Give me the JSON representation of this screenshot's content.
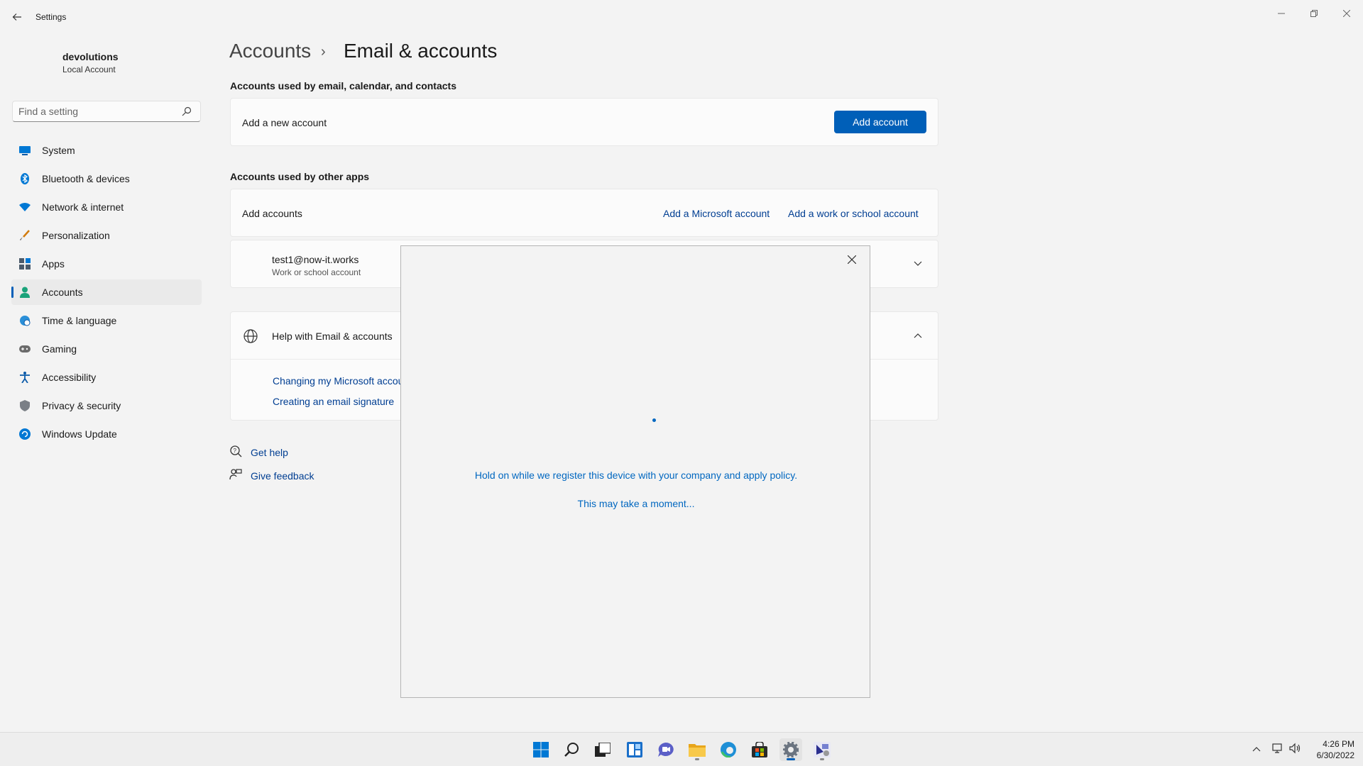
{
  "window": {
    "title": "Settings",
    "back_icon": "back-arrow-icon",
    "controls": [
      "minimize-icon",
      "restore-icon",
      "close-icon"
    ]
  },
  "profile": {
    "name": "devolutions",
    "type": "Local Account"
  },
  "search": {
    "placeholder": "Find a setting",
    "value": ""
  },
  "sidebar": {
    "active_index": 5,
    "items": [
      {
        "label": "System",
        "icon": "system-icon"
      },
      {
        "label": "Bluetooth & devices",
        "icon": "bluetooth-icon"
      },
      {
        "label": "Network & internet",
        "icon": "wifi-icon"
      },
      {
        "label": "Personalization",
        "icon": "brush-icon"
      },
      {
        "label": "Apps",
        "icon": "apps-icon"
      },
      {
        "label": "Accounts",
        "icon": "person-icon"
      },
      {
        "label": "Time & language",
        "icon": "globe-clock-icon"
      },
      {
        "label": "Gaming",
        "icon": "gamepad-icon"
      },
      {
        "label": "Accessibility",
        "icon": "accessibility-icon"
      },
      {
        "label": "Privacy & security",
        "icon": "shield-icon"
      },
      {
        "label": "Windows Update",
        "icon": "update-icon"
      }
    ]
  },
  "breadcrumb": {
    "root": "Accounts",
    "separator": "›",
    "current": "Email & accounts"
  },
  "email_section": {
    "title": "Accounts used by email, calendar, and contacts",
    "row_label": "Add a new account",
    "button": "Add account"
  },
  "apps_section": {
    "title": "Accounts used by other apps",
    "row_label": "Add accounts",
    "link_microsoft": "Add a Microsoft account",
    "link_work": "Add a work or school account",
    "account": {
      "email": "test1@now-it.works",
      "type": "Work or school account"
    }
  },
  "help_section": {
    "title": "Help with Email & accounts",
    "links": [
      "Changing my Microsoft account",
      "Creating an email signature"
    ]
  },
  "footer_links": {
    "get_help": "Get help",
    "give_feedback": "Give feedback"
  },
  "dialog": {
    "message": "Hold on while we register this device with your company and apply policy.",
    "submessage": "This may take a moment..."
  },
  "taskbar": {
    "icons": [
      "start-icon",
      "search-icon",
      "task-view-icon",
      "widgets-icon",
      "chat-icon",
      "file-explorer-icon",
      "edge-icon",
      "store-icon",
      "settings-icon",
      "remote-desktop-manager-icon"
    ]
  },
  "clock": {
    "time": "4:26 PM",
    "date": "6/30/2022"
  },
  "colors": {
    "accent": "#005fb8",
    "link": "#003e92",
    "dialog_text": "#0067c0"
  }
}
